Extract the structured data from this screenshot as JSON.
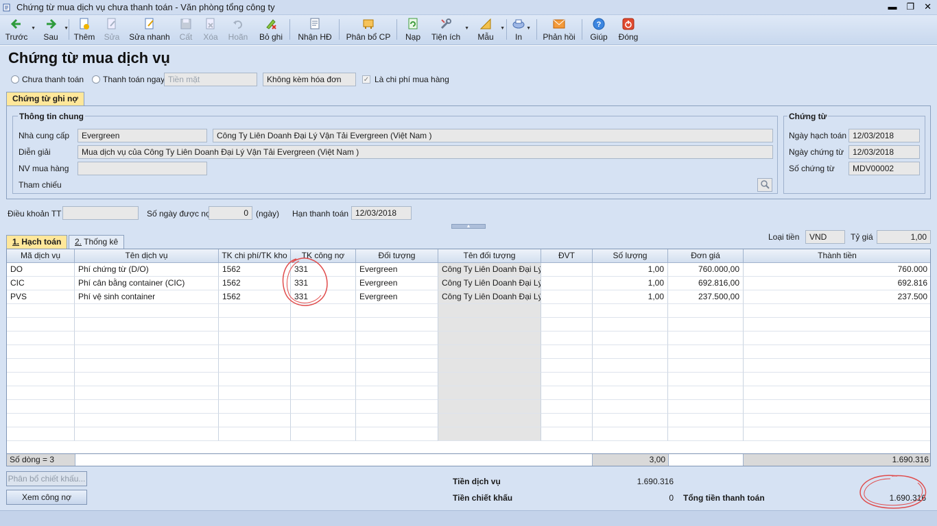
{
  "window": {
    "title": "Chứng từ mua dịch vụ chưa thanh toán - Văn phòng tổng công ty"
  },
  "toolbar": {
    "prev": "Trước",
    "next": "Sau",
    "add": "Thêm",
    "edit": "Sửa",
    "quick_edit": "Sửa nhanh",
    "save": "Cất",
    "delete": "Xóa",
    "undo": "Hoãn",
    "unpost": "Bỏ ghi",
    "receive_invoice": "Nhận HĐ",
    "allocate": "Phân bổ CP",
    "load": "Nạp",
    "utilities": "Tiện ích",
    "template": "Mẫu",
    "print": "In",
    "feedback": "Phản hồi",
    "help": "Giúp",
    "close": "Đóng"
  },
  "page": {
    "title": "Chứng từ mua dịch vụ"
  },
  "payment": {
    "unpaid_label": "Chưa thanh toán",
    "pay_now_label": "Thanh toán ngay",
    "method": "Tiền mặt",
    "invoice_type": "Không kèm hóa đơn",
    "is_purchase_cost_label": "Là chi phí mua hàng"
  },
  "doc_tab": {
    "label": "Chứng từ ghi nợ"
  },
  "general": {
    "title": "Thông tin chung",
    "supplier_label": "Nhà cung cấp",
    "supplier_code": "Evergreen",
    "supplier_name": "Công Ty Liên Doanh Đại Lý Vận Tải Evergreen (Việt Nam )",
    "desc_label": "Diễn giải",
    "desc": "Mua dịch vụ của Công Ty Liên Doanh Đại Lý Vận Tải Evergreen (Việt Nam )",
    "staff_label": "NV mua hàng",
    "ref_label": "Tham chiếu"
  },
  "voucher": {
    "title": "Chứng từ",
    "posting_date_label": "Ngày hạch toán",
    "posting_date": "12/03/2018",
    "doc_date_label": "Ngày chứng từ",
    "doc_date": "12/03/2018",
    "doc_no_label": "Số chứng từ",
    "doc_no": "MDV00002"
  },
  "terms": {
    "terms_label": "Điều khoản TT",
    "days_label": "Số ngày được nợ",
    "days": "0",
    "days_unit": "(ngày)",
    "due_label": "Hạn thanh toán",
    "due": "12/03/2018"
  },
  "tabs": {
    "accounting": "Hạch toán",
    "accounting_key": "1.",
    "stats": "Thống kê",
    "stats_key": "2."
  },
  "currency": {
    "label": "Loại tiền",
    "value": "VND",
    "rate_label": "Tỷ giá",
    "rate": "1,00"
  },
  "grid": {
    "headers": [
      "Mã dịch vụ",
      "Tên dịch vụ",
      "TK chi phí/TK kho",
      "TK công nợ",
      "Đối tượng",
      "Tên đối tượng",
      "ĐVT",
      "Số lượng",
      "Đơn giá",
      "Thành tiền"
    ],
    "rows": [
      [
        "DO",
        "Phí chứng từ (D/O)",
        "1562",
        "331",
        "Evergreen",
        "Công Ty Liên Doanh Đại Lý",
        "",
        "1,00",
        "760.000,00",
        "760.000"
      ],
      [
        "CIC",
        "Phí cân bằng container (CIC)",
        "1562",
        "331",
        "Evergreen",
        "Công Ty Liên Doanh Đại Lý",
        "",
        "1,00",
        "692.816,00",
        "692.816"
      ],
      [
        "PVS",
        "Phí vệ sinh container",
        "1562",
        "331",
        "Evergreen",
        "Công Ty Liên Doanh Đại Lý",
        "",
        "1,00",
        "237.500,00",
        "237.500"
      ]
    ],
    "footer": {
      "rows_count": "Số dòng = 3",
      "total_qty": "3,00",
      "total_amount": "1.690.316"
    }
  },
  "bottom": {
    "allocate_discount": "Phân bổ chiết khấu...",
    "view_debt": "Xem công nợ",
    "service_amount_label": "Tiền dịch vụ",
    "service_amount": "1.690.316",
    "discount_label": "Tiền chiết khấu",
    "discount": "0",
    "total_label": "Tổng tiền thanh toán",
    "total": "1.690.316"
  },
  "colors": {
    "accent": "#d6e2f3",
    "annotation": "#e04b4b",
    "tab_active": "#ffe79a"
  }
}
